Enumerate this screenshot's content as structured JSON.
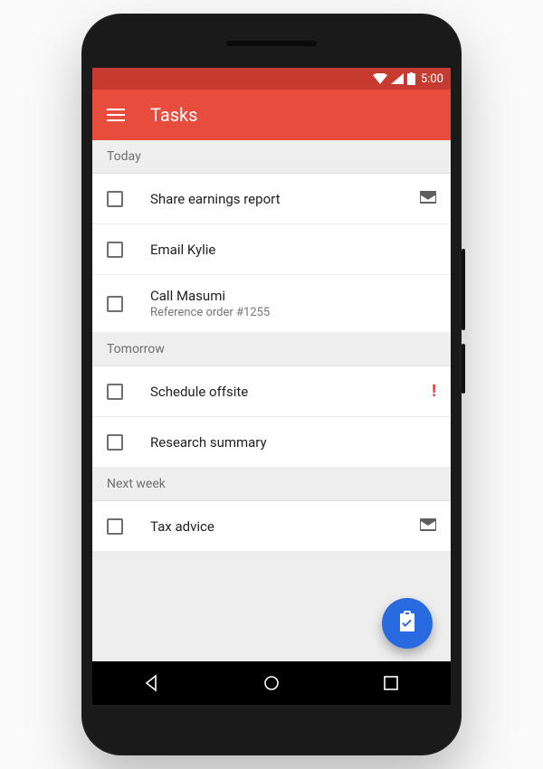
{
  "status": {
    "time": "5:00"
  },
  "appbar": {
    "title": "Tasks"
  },
  "sections": [
    {
      "label": "Today",
      "items": [
        {
          "title": "Share earnings report",
          "sub": "",
          "icon": "mail"
        },
        {
          "title": "Email Kylie",
          "sub": "",
          "icon": ""
        },
        {
          "title": "Call Masumi",
          "sub": "Reference order #1255",
          "icon": ""
        }
      ]
    },
    {
      "label": "Tomorrow",
      "items": [
        {
          "title": "Schedule offsite",
          "sub": "",
          "icon": "priority"
        },
        {
          "title": "Research summary",
          "sub": "",
          "icon": ""
        }
      ]
    },
    {
      "label": "Next week",
      "items": [
        {
          "title": "Tax advice",
          "sub": "",
          "icon": "mail"
        }
      ]
    }
  ],
  "fab": {
    "icon": "clipboard-check"
  },
  "colors": {
    "statusbar": "#c73a2f",
    "appbar": "#e74c3c",
    "fab": "#2a6ae0",
    "priority": "#e53935"
  }
}
